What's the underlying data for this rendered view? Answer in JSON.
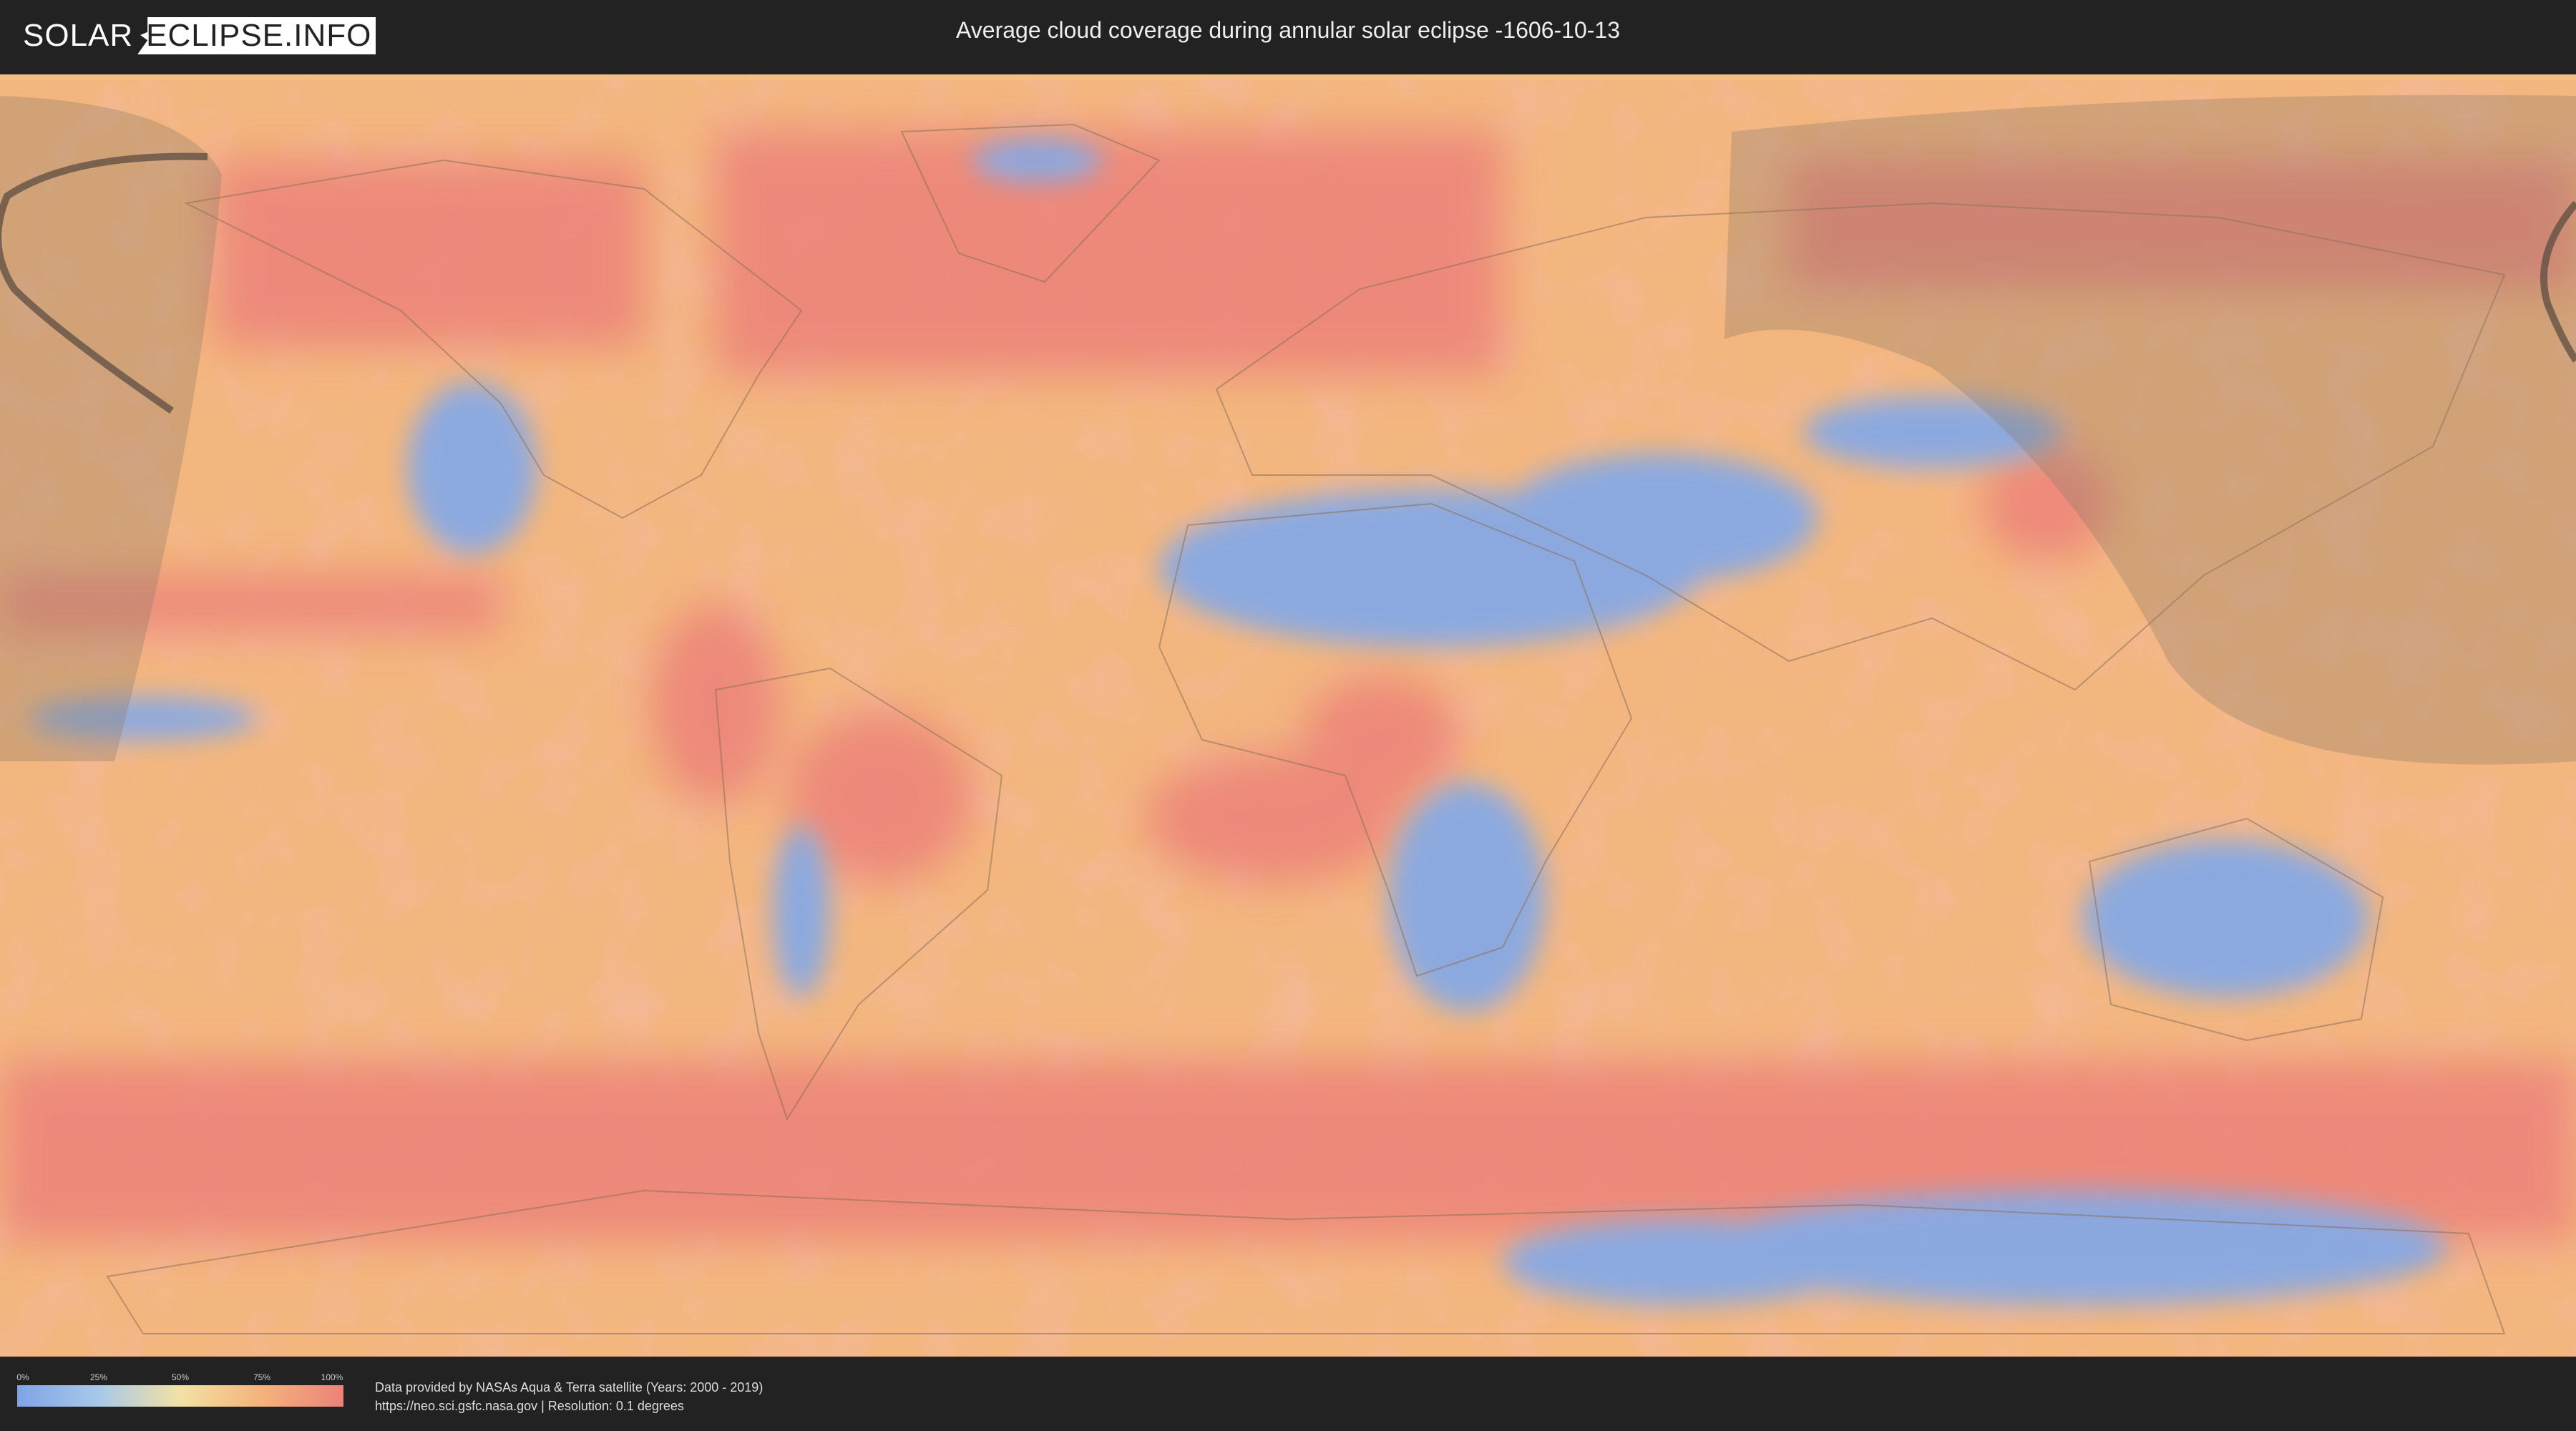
{
  "header": {
    "logo_left": "SOLAR",
    "logo_right": "ECLIPSE.INFO",
    "title": "Average cloud coverage during annular solar eclipse -1606-10-13"
  },
  "legend": {
    "ticks": [
      "0%",
      "25%",
      "50%",
      "75%",
      "100%"
    ],
    "colors": [
      "#7fa3e6",
      "#a8c8e8",
      "#f2e1a4",
      "#f4b27c",
      "#ec8279"
    ]
  },
  "footer": {
    "credit_line1": "Data provided by NASAs Aqua & Terra satellite (Years: 2000 - 2019)",
    "credit_line2": "https://neo.sci.gsfc.nasa.gov | Resolution: 0.1 degrees"
  },
  "map": {
    "ocean_color": "#f2b279",
    "cloudy_color": "#ec8279",
    "clear_color": "#86a9e4",
    "eclipse_shadow_color": "#8a7a66"
  }
}
